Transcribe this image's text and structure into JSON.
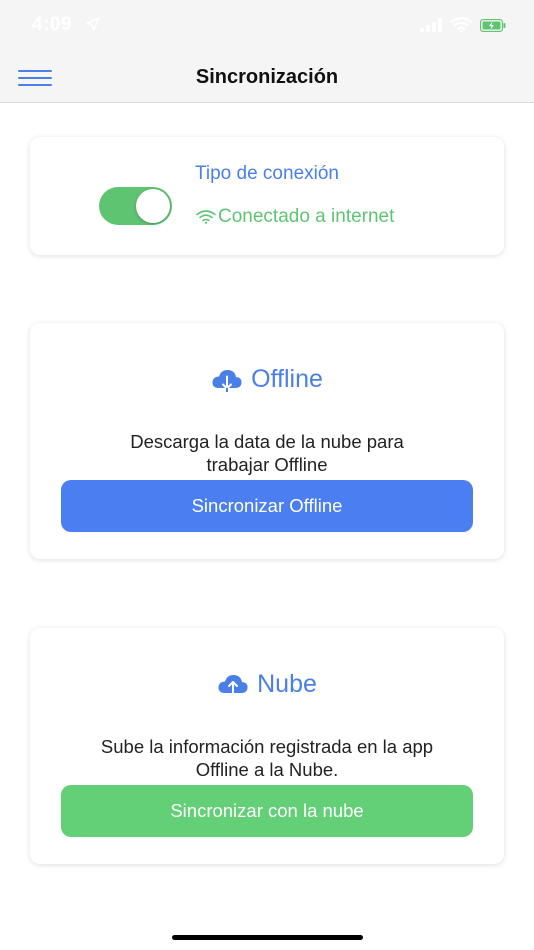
{
  "status_bar": {
    "time": "4:09"
  },
  "nav": {
    "title": "Sincronización"
  },
  "connection_card": {
    "title": "Tipo de conexión",
    "toggle_on": true,
    "status_text": "Conectado a internet"
  },
  "offline_card": {
    "heading": "Offline",
    "description_line1": "Descarga la data de la nube para",
    "description_line2": "trabajar Offline",
    "button_label": "Sincronizar Offline"
  },
  "cloud_card": {
    "heading": "Nube",
    "description_line1": "Sube la información registrada en la app",
    "description_line2": "Offline a la Nube.",
    "button_label": "Sincronizar con la nube"
  },
  "icons": {
    "menu": "hamburger-menu-icon",
    "download": "cloud-download-icon",
    "upload": "cloud-upload-icon",
    "wifi": "wifi-icon"
  },
  "colors": {
    "accent_blue": "#4a7fe8",
    "accent_green": "#5fc472",
    "button_blue": "#4b7ef0",
    "button_green": "#63cf77"
  }
}
